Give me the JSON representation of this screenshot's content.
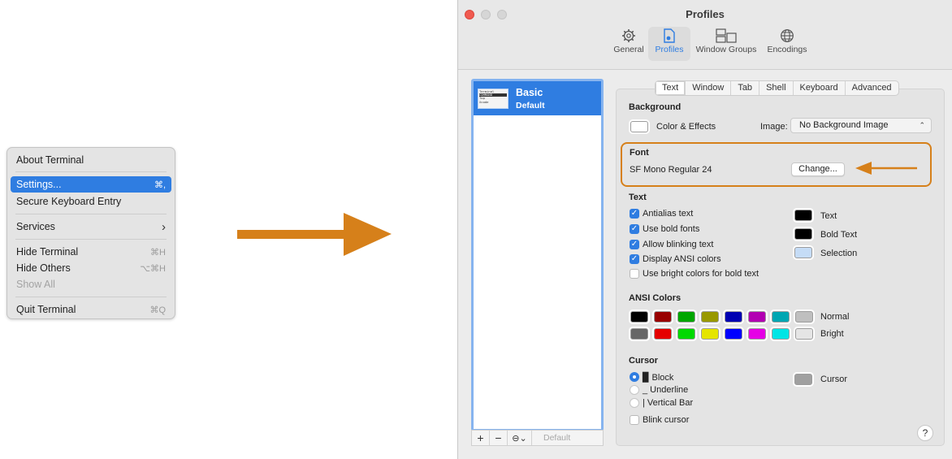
{
  "menu": {
    "items": [
      {
        "label": "About Terminal",
        "shortcut": ""
      },
      {
        "label": "Settings...",
        "shortcut": "⌘,"
      },
      {
        "label": "Secure Keyboard Entry",
        "shortcut": ""
      },
      {
        "label": "Services",
        "shortcut": "›"
      },
      {
        "label": "Hide Terminal",
        "shortcut": "⌘H"
      },
      {
        "label": "Hide Others",
        "shortcut": "⌥⌘H"
      },
      {
        "label": "Show All",
        "shortcut": ""
      },
      {
        "label": "Quit Terminal",
        "shortcut": "⌘Q"
      }
    ]
  },
  "window": {
    "title": "Profiles",
    "toolbar": {
      "general": "General",
      "profiles": "Profiles",
      "window_groups": "Window Groups",
      "encodings": "Encodings"
    }
  },
  "profiles": {
    "selected_name": "Basic",
    "selected_sub": "Default",
    "thumb_lines": [
      "Terminal",
      "COMMAND",
      "Top",
      "Xcode"
    ],
    "footer": {
      "add": "+",
      "remove": "−",
      "more": "⊖⌄",
      "default": "Default"
    }
  },
  "tabs": [
    "Text",
    "Window",
    "Tab",
    "Shell",
    "Keyboard",
    "Advanced"
  ],
  "background": {
    "header": "Background",
    "color_effects": "Color & Effects",
    "image_label": "Image:",
    "image_value": "No Background Image"
  },
  "font": {
    "header": "Font",
    "value": "SF Mono Regular 24",
    "change_button": "Change..."
  },
  "text": {
    "header": "Text",
    "antialias": "Antialias text",
    "bold_fonts": "Use bold fonts",
    "blinking": "Allow blinking text",
    "ansi": "Display ANSI colors",
    "bright_bold": "Use bright colors for bold text",
    "text_color_label": "Text",
    "bold_color_label": "Bold Text",
    "selection_label": "Selection"
  },
  "ansi": {
    "header": "ANSI Colors",
    "normal_label": "Normal",
    "bright_label": "Bright",
    "normal": [
      "#000000",
      "#990000",
      "#00a600",
      "#999900",
      "#0000b2",
      "#b200b2",
      "#00a6b2",
      "#bfbfbf"
    ],
    "bright": [
      "#666666",
      "#e50000",
      "#00d900",
      "#e5e500",
      "#0000ff",
      "#e500e5",
      "#00e5e5",
      "#e5e5e5"
    ]
  },
  "cursor": {
    "header": "Cursor",
    "block": "▉ Block",
    "underline": "_ Underline",
    "vertical": "| Vertical Bar",
    "blink": "Blink cursor",
    "color_label": "Cursor"
  },
  "help": "?",
  "colors": {
    "accent": "#2f7de1",
    "highlight_orange": "#d6801a"
  }
}
